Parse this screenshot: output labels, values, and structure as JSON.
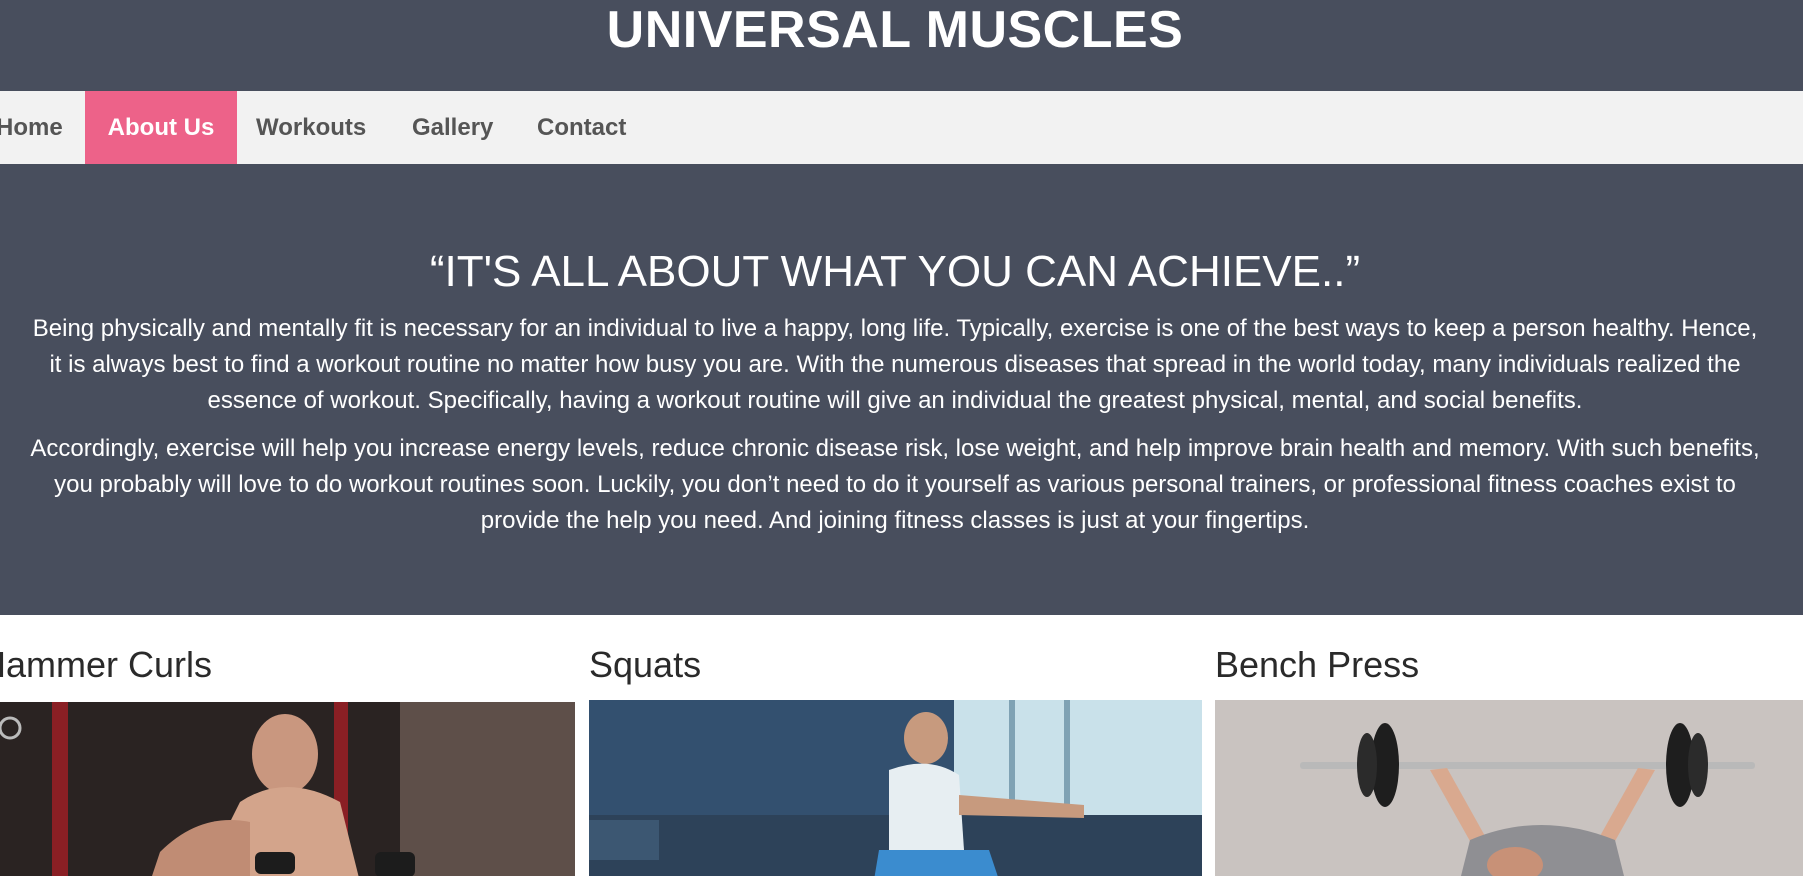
{
  "header": {
    "title": "UNIVERSAL MUSCLES"
  },
  "nav": {
    "items": [
      {
        "label": "Home",
        "active": false
      },
      {
        "label": "About Us",
        "active": true
      },
      {
        "label": "Workouts",
        "active": false
      },
      {
        "label": "Gallery",
        "active": false
      },
      {
        "label": "Contact",
        "active": false
      }
    ]
  },
  "hero": {
    "quote": "“IT'S ALL ABOUT WHAT YOU CAN ACHIEVE..”",
    "paragraph_1": "Being physically and mentally fit is necessary for an individual to live a happy, long life. Typically, exercise is one of the best ways to keep a person healthy. Hence, it is always best to find a workout routine no matter how busy you are. With the numerous diseases that spread in the world today, many individuals realized the essence of workout. Specifically, having a workout routine will give an individual the greatest physical, mental, and social benefits.",
    "paragraph_2": "Accordingly, exercise will help you increase energy levels, reduce chronic disease risk, lose weight, and help improve brain health and memory. With such benefits, you probably will love to do workout routines soon. Luckily, you don’t need to do it yourself as various personal trainers, or professional fitness coaches exist to provide the help you need. And joining fitness classes is just at your fingertips."
  },
  "workouts": [
    {
      "title": "Hammer Curls"
    },
    {
      "title": "Squats"
    },
    {
      "title": "Bench Press"
    }
  ],
  "colors": {
    "dark_bg": "#484e5d",
    "nav_bg": "#f2f2f2",
    "accent": "#ed6289",
    "nav_text": "#555555"
  }
}
